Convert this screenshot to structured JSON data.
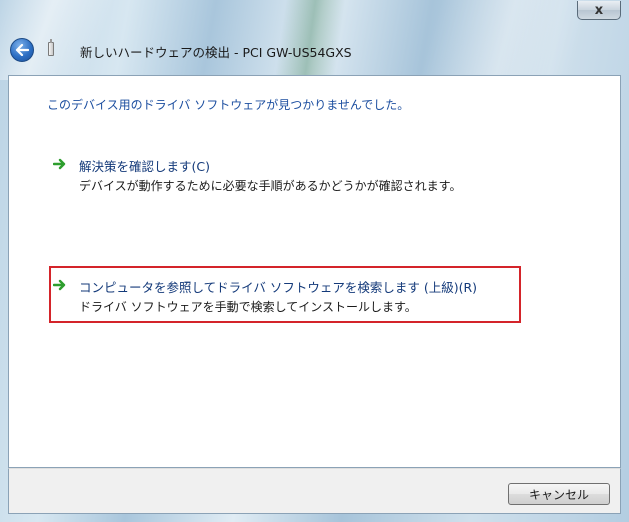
{
  "window": {
    "title": "新しいハードウェアの検出 - PCI GW-US54GXS",
    "close_label": "x"
  },
  "content": {
    "heading": "このデバイス用のドライバ ソフトウェアが見つかりませんでした。",
    "options": [
      {
        "title": "解決策を確認します(C)",
        "description": "デバイスが動作するために必要な手順があるかどうかが確認されます。",
        "icon": "green-arrow-icon"
      },
      {
        "title": "コンピュータを参照してドライバ ソフトウェアを検索します (上級)(R)",
        "description": "ドライバ ソフトウェアを手動で検索してインストールします。",
        "icon": "green-arrow-icon",
        "highlight_color": "#d4242a"
      }
    ]
  },
  "footer": {
    "cancel_label": "キャンセル"
  },
  "colors": {
    "accent": "#1d4fa0",
    "arrow": "#2e9e2e",
    "highlight": "#d4242a"
  }
}
